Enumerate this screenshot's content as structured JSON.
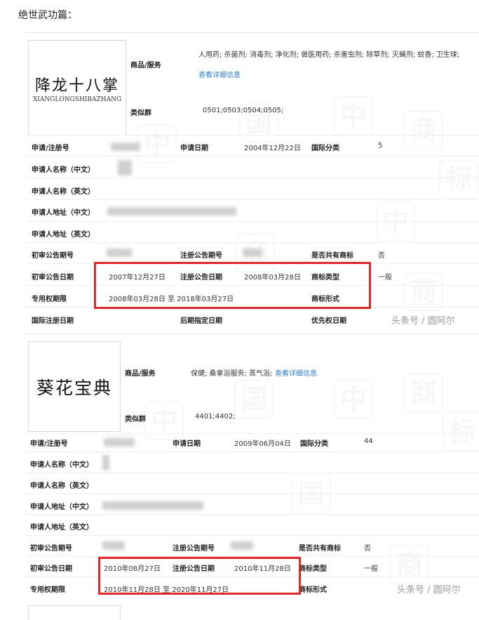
{
  "heading": "绝世武功篇：",
  "labels": {
    "goods": "商品/服务",
    "similar": "类似群",
    "reg_no": "申请/注册号",
    "app_date": "申请日期",
    "intl_class": "国际分类",
    "name_cn": "申请人名称（中文）",
    "name_en": "申请人名称（英文）",
    "addr_cn": "申请人地址（中文）",
    "addr_en": "申请人地址（英文）",
    "prelim_no": "初审公告期号",
    "reg_pub_no": "注册公告期号",
    "shared": "是否共有商标",
    "prelim_date": "初审公告日期",
    "reg_pub_date": "注册公告日期",
    "tm_type": "商标类型",
    "excl_period": "专用权期限",
    "tm_form": "商标形式",
    "intl_reg_date": "国际注册日期",
    "later_date": "后期指定日期",
    "priority_date": "优先权日期"
  },
  "card1": {
    "logo_text": "降龙十八掌",
    "logo_sub": "XIANGLONGSHIBAZHANG",
    "goods_value": "人用药; 杀菌剂; 消毒剂; 净化剂; 兽医用药; 杀害虫剂; 除草剂; 灭蝇剂; 蚊香; 卫生球;",
    "detail_link": "查看详细信息",
    "similar_value": "0501;0503;0504;0505;",
    "app_date": "2004年12月22日",
    "intl_class": "5",
    "shared": "否",
    "prelim_date": "2007年12月27日",
    "reg_pub_date": "2008年03月28日",
    "tm_type": "一般",
    "excl_period": "2008年03月28日 至 2018年03月27日"
  },
  "card2": {
    "logo_text": "葵花宝典",
    "goods_value": "保健; 桑拿浴服务; 蒸气浴;",
    "detail_link": "查看详细信息",
    "similar_value": "4401;4402;",
    "app_date": "2009年06月04日",
    "intl_class": "44",
    "shared": "否",
    "prelim_date": "2010年08月27日",
    "reg_pub_date": "2010年11月28日",
    "tm_type": "一般",
    "excl_period": "2010年11月28日 至 2020年11月27日"
  },
  "watermark": "头条号 / 圆阿尔",
  "watermark2": "头条号 / 圆阿尔",
  "bg_watermark_chars": [
    "中",
    "国",
    "商",
    "标"
  ],
  "colors": {
    "highlight": "#e02a2a",
    "link": "#2a7cc7"
  }
}
